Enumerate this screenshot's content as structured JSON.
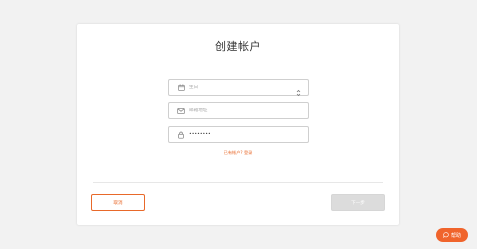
{
  "form": {
    "title": "创建帐户",
    "date_placeholder": "生日",
    "email_placeholder": "邮箱地址",
    "password_value": "••••••••",
    "login_link": "已有帐户? 登录",
    "cancel_label": "取消",
    "next_label": "下一步"
  },
  "help": {
    "label": "帮助"
  },
  "colors": {
    "accent": "#e8692a",
    "help_bg": "#f0642c",
    "disabled_bg": "#dcdcdc"
  },
  "icons": {
    "date": "calendar-icon",
    "email": "mail-icon",
    "password": "lock-icon",
    "select": "chevron-updown-icon",
    "help": "chat-bubble-icon"
  }
}
